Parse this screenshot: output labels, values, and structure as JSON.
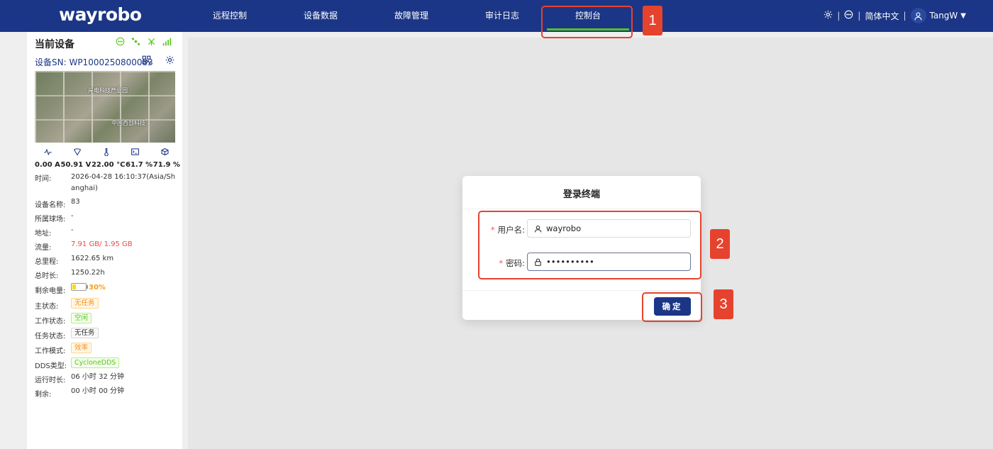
{
  "header": {
    "logo": "wayrobo",
    "nav": [
      "远程控制",
      "设备数据",
      "故障管理",
      "审计日志",
      "控制台"
    ],
    "language": "简体中文",
    "user": "TangW"
  },
  "sidebar": {
    "title": "当前设备",
    "sn": "设备SN: WP1000250800083",
    "map_labels": [
      "岸电科技产业园",
      "中国西部科技"
    ],
    "metrics": [
      "0.00 A",
      "50.91 V",
      "22.00 °C",
      "61.7 %",
      "71.9 %"
    ],
    "info": {
      "time_label": "时间:",
      "time_value": "2026-04-28 16:10:37(Asia/Shanghai)",
      "name_label": "设备名称:",
      "name_value": "83",
      "field_label": "所属球场:",
      "field_value": "-",
      "address_label": "地址:",
      "address_value": "-",
      "traffic_label": "流量:",
      "traffic_value": "7.91 GB/ 1.95 GB",
      "mileage_label": "总里程:",
      "mileage_value": "1622.65 km",
      "duration_label": "总时长:",
      "duration_value": "1250.22h",
      "battery_label": "剩余电量:",
      "battery_value": "30%",
      "battery_level": 0.3,
      "main_status_label": "主状态:",
      "main_status_value": "无任务",
      "work_status_label": "工作状态:",
      "work_status_value": "空闲",
      "task_status_label": "任务状态:",
      "task_status_value": "无任务",
      "work_mode_label": "工作模式:",
      "work_mode_value": "效率",
      "dds_label": "DDS类型:",
      "dds_value": "CycloneDDS",
      "runtime_label": "运行时长:",
      "runtime_value": "06 小时 32 分钟",
      "remaining_label": "剩余:",
      "remaining_value": "00 小时 00 分钟"
    }
  },
  "modal": {
    "title": "登录终端",
    "username_label": "用户名:",
    "username_value": "wayrobo",
    "password_label": "密码:",
    "password_value": "••••••••••",
    "ok_label": "确定"
  },
  "annotations": [
    "1",
    "2",
    "3"
  ],
  "colors": {
    "primary": "#1b3686",
    "accent_green": "#52c41a",
    "annotation_red": "#e5432e"
  }
}
